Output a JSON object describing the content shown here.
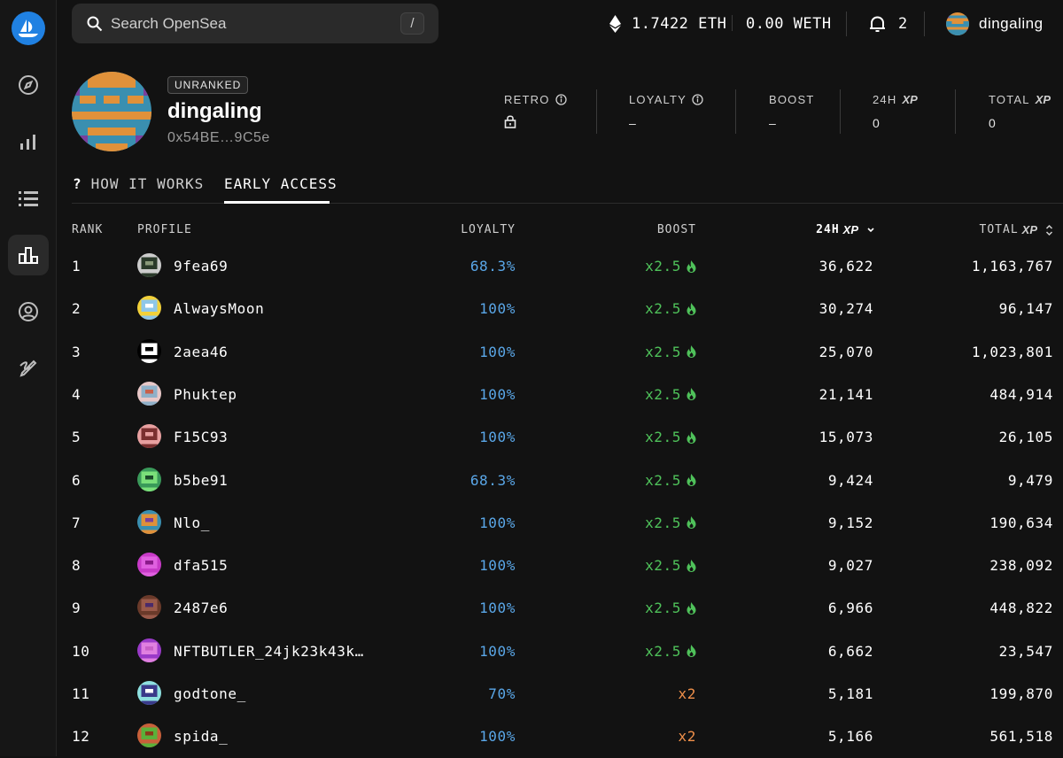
{
  "colors": {
    "accent_blue": "#2081e2",
    "loyalty_blue": "#5aa7e8",
    "boost_green": "#4fc25a",
    "boost_orange": "#f0904a"
  },
  "search": {
    "placeholder": "Search OpenSea",
    "shortcut": "/"
  },
  "wallet": {
    "eth": "1.7422 ETH",
    "weth": "0.00 WETH",
    "notifications": "2",
    "username": "dingaling"
  },
  "profile": {
    "badge": "UNRANKED",
    "name": "dingaling",
    "address": "0x54BE…9C5e",
    "stats": [
      {
        "label": "RETRO",
        "value": "",
        "icon": "lock-icon"
      },
      {
        "label": "LOYALTY",
        "value": "–"
      },
      {
        "label": "BOOST",
        "value": "–"
      },
      {
        "label": "24H",
        "suffix": "XP",
        "value": "0"
      },
      {
        "label": "TOTAL",
        "suffix": "XP",
        "value": "0"
      }
    ]
  },
  "tabs": [
    {
      "label": "HOW IT WORKS",
      "icon": "question-icon"
    },
    {
      "label": "EARLY ACCESS",
      "active": true
    }
  ],
  "table": {
    "headers": {
      "rank": "RANK",
      "profile": "PROFILE",
      "loyalty": "LOYALTY",
      "boost": "BOOST",
      "h24": "24H",
      "total": "TOTAL",
      "xp": "XP"
    },
    "rows": [
      {
        "rank": "1",
        "name": "9fea69",
        "loyalty": "68.3%",
        "boost": "x2.5",
        "h24": "36,622",
        "total": "1,163,767"
      },
      {
        "rank": "2",
        "name": "AlwaysMoon",
        "loyalty": "100%",
        "boost": "x2.5",
        "h24": "30,274",
        "total": "96,147"
      },
      {
        "rank": "3",
        "name": "2aea46",
        "loyalty": "100%",
        "boost": "x2.5",
        "h24": "25,070",
        "total": "1,023,801"
      },
      {
        "rank": "4",
        "name": "Phuktep",
        "loyalty": "100%",
        "boost": "x2.5",
        "h24": "21,141",
        "total": "484,914"
      },
      {
        "rank": "5",
        "name": "F15C93",
        "loyalty": "100%",
        "boost": "x2.5",
        "h24": "15,073",
        "total": "26,105"
      },
      {
        "rank": "6",
        "name": "b5be91",
        "loyalty": "68.3%",
        "boost": "x2.5",
        "h24": "9,424",
        "total": "9,479"
      },
      {
        "rank": "7",
        "name": "Nlo_",
        "loyalty": "100%",
        "boost": "x2.5",
        "h24": "9,152",
        "total": "190,634"
      },
      {
        "rank": "8",
        "name": "dfa515",
        "loyalty": "100%",
        "boost": "x2.5",
        "h24": "9,027",
        "total": "238,092"
      },
      {
        "rank": "9",
        "name": "2487e6",
        "loyalty": "100%",
        "boost": "x2.5",
        "h24": "6,966",
        "total": "448,822"
      },
      {
        "rank": "10",
        "name": "NFTBUTLER_24jk23k43k…",
        "loyalty": "100%",
        "boost": "x2.5",
        "h24": "6,662",
        "total": "23,547"
      },
      {
        "rank": "11",
        "name": "godtone_",
        "loyalty": "70%",
        "boost": "x2",
        "h24": "5,181",
        "total": "199,870"
      },
      {
        "rank": "12",
        "name": "spida_",
        "loyalty": "100%",
        "boost": "x2",
        "h24": "5,166",
        "total": "561,518"
      }
    ]
  }
}
